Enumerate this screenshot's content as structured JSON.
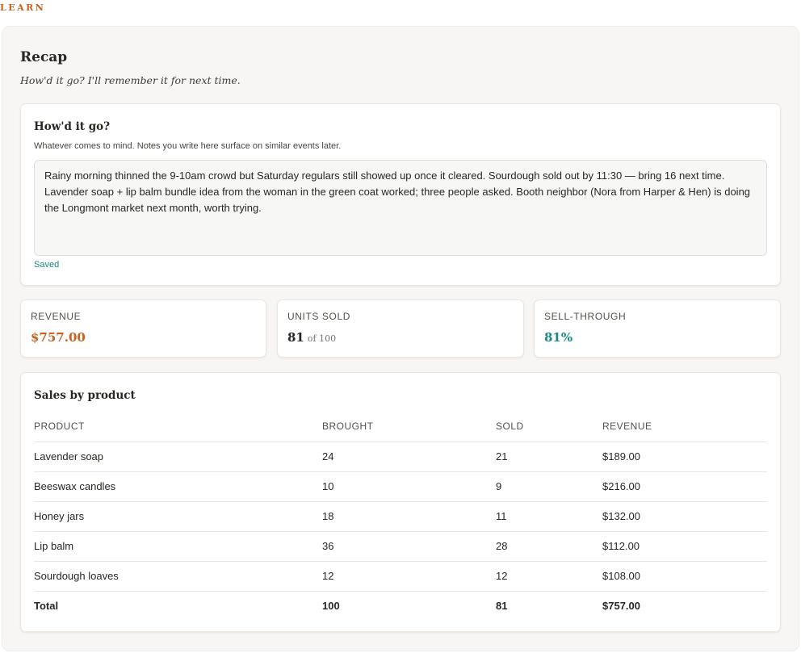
{
  "section_label": "LEARN",
  "recap": {
    "title": "Recap",
    "subtitle": "How'd it go? I'll remember it for next time."
  },
  "notes": {
    "title": "How'd it go?",
    "help": "Whatever comes to mind. Notes you write here surface on similar events later.",
    "value": "Rainy morning thinned the 9-10am crowd but Saturday regulars still showed up once it cleared. Sourdough sold out by 11:30 — bring 16 next time. Lavender soap + lip balm bundle idea from the woman in the green coat worked; three people asked. Booth neighbor (Nora from Harper & Hen) is doing the Longmont market next month, worth trying.",
    "status": "Saved"
  },
  "stats": {
    "revenue": {
      "label": "REVENUE",
      "value": "$757.00"
    },
    "units": {
      "label": "UNITS SOLD",
      "value": "81",
      "of": "of 100"
    },
    "sell_through": {
      "label": "SELL-THROUGH",
      "value": "81%"
    }
  },
  "sales": {
    "title": "Sales by product",
    "headers": [
      "PRODUCT",
      "BROUGHT",
      "SOLD",
      "REVENUE"
    ],
    "rows": [
      [
        "Lavender soap",
        "24",
        "21",
        "$189.00"
      ],
      [
        "Beeswax candles",
        "10",
        "9",
        "$216.00"
      ],
      [
        "Honey jars",
        "18",
        "11",
        "$132.00"
      ],
      [
        "Lip balm",
        "36",
        "28",
        "$112.00"
      ],
      [
        "Sourdough loaves",
        "12",
        "12",
        "$108.00"
      ]
    ],
    "total": [
      "Total",
      "100",
      "81",
      "$757.00"
    ]
  },
  "colors": {
    "accent": "#c8611e",
    "teal": "#1a8a80",
    "panel": "#f7f6f5"
  }
}
